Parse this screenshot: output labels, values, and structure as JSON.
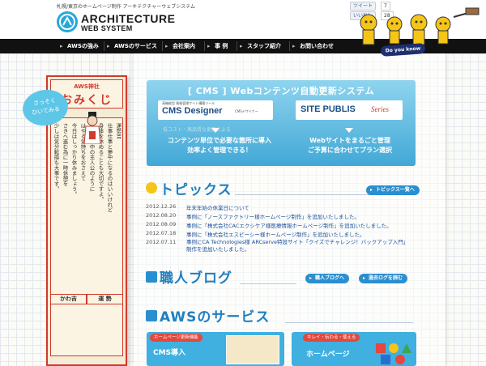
{
  "header": {
    "tagline": "札幌/東京のホームページ制作 アーキテクチャーウェブシステム",
    "logo_line1": "ARCHITECTURE",
    "logo_line2": "WEB SYSTEM",
    "social": {
      "tweet_label": "ツイート",
      "tweet_count": "7",
      "like_label": "いいね！",
      "like_count": "28"
    }
  },
  "nav": {
    "items": [
      {
        "label": "AWSの強み"
      },
      {
        "label": "AWSのサービス"
      },
      {
        "label": "会社案内"
      },
      {
        "label": "事 例"
      },
      {
        "label": "スタッフ紹介"
      },
      {
        "label": "お問い合わせ"
      }
    ]
  },
  "mascot": {
    "badge": "Do you know AWS?"
  },
  "omikuji": {
    "head_small": "AWS神社",
    "head_title": "おみくじ",
    "bubble_line1": "さっそく",
    "bubble_line2": "ひいてみる",
    "columns": [
      "仕事仕事と夢中になるのはいいけれど",
      "身体を休めることも大切ですよ。",
      "ゲームの中の主人公のように",
      "はやる気持ちをおさえて",
      "今日はしっかり休みましょう。",
      "さきへ進む為に一時休憩を",
      "少しは気分転換も大事です。",
      "運勢吉"
    ],
    "luck_left": "かわ吉",
    "luck_right": "運 勢"
  },
  "banner": {
    "title": "[ CMS ] Webコンテンツ自動更新システム",
    "left_card_sub": "高機能型 情報管理サイト構築ツール",
    "left_card_main": "CMS Designer",
    "left_card_tag": "CMSデザイナー",
    "right_card_main": "SITE PUBLIS",
    "right_card_series": "Series",
    "ghost_text": "低コスト・高品質な更新による",
    "left_desc_1": "コンテンツ単位で必要な箇所に導入",
    "left_desc_2": "効率よく管理できる！",
    "right_desc_1": "Webサイトをまるごと管理",
    "right_desc_2": "ご予算に合わせてプラン選択"
  },
  "topics": {
    "title": "トピックス",
    "list_button": "トピックス一覧へ",
    "items": [
      {
        "date": "2012.12.26",
        "text": "年末年始の休業日について"
      },
      {
        "date": "2012.08.20",
        "text": "事例に「ノースファクトリー様ホームページ制作」を追加いたしました。"
      },
      {
        "date": "2012.08.09",
        "text": "事例に「株式会社CACエクシケア様医療情報ホームページ制作」を追加いたしました。"
      },
      {
        "date": "2012.07.18",
        "text": "事例に「株式会社エスピーシー様ホームページ制作」を追加いたしました。"
      },
      {
        "date": "2012.07.11",
        "text": "事例にCA Technologies様 ARCserve特設サイト「クイズでチャレンジ！バックアップ入門」制作を追加いたしました。"
      }
    ]
  },
  "blog": {
    "title": "職人ブログ",
    "blog_button": "職人ブログへ",
    "past_button": "過去ログを読む"
  },
  "services": {
    "title": "AWSのサービス",
    "left_label": "ホームページ更新機能",
    "left_title": "CMS導入",
    "right_label": "キレイ・伝わる・使える",
    "right_title": "ホームページ"
  },
  "colors": {
    "accent_blue": "#2a8fd0",
    "nav_bg": "#111111",
    "omikuji_red": "#d23a2c"
  }
}
